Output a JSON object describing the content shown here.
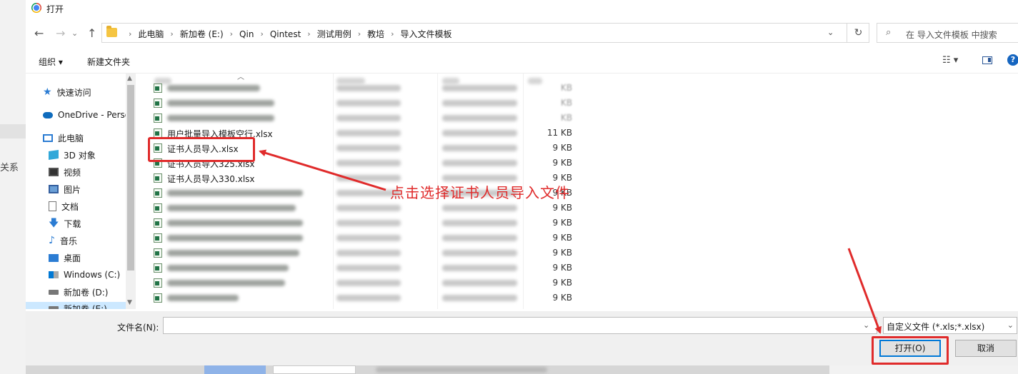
{
  "window": {
    "title": "打开"
  },
  "nav": {
    "back": "←",
    "forward": "→",
    "up": "↑",
    "refresh": "↻"
  },
  "breadcrumbs": [
    "此电脑",
    "新加卷 (E:)",
    "Qin",
    "Qintest",
    "测试用例",
    "教培",
    "导入文件模板"
  ],
  "search": {
    "placeholder": "在 导入文件模板 中搜索"
  },
  "toolbar": {
    "organize": "组织 ▾",
    "new_folder": "新建文件夹",
    "view": "☷ ▾"
  },
  "sidebar": {
    "items": [
      {
        "label": "快速访问",
        "icon": "star-icon"
      },
      {
        "label": "OneDrive - Perso",
        "icon": "cloud-icon"
      },
      {
        "label": "此电脑",
        "icon": "computer-icon"
      },
      {
        "label": "3D 对象",
        "icon": "cube-icon"
      },
      {
        "label": "视频",
        "icon": "video-icon"
      },
      {
        "label": "图片",
        "icon": "image-icon"
      },
      {
        "label": "文档",
        "icon": "document-icon"
      },
      {
        "label": "下载",
        "icon": "download-icon"
      },
      {
        "label": "音乐",
        "icon": "music-icon"
      },
      {
        "label": "桌面",
        "icon": "desktop-icon"
      },
      {
        "label": "Windows (C:)",
        "icon": "windows-drive-icon"
      },
      {
        "label": "新加卷 (D:)",
        "icon": "drive-icon"
      },
      {
        "label": "新加卷 (E:)",
        "icon": "drive-icon"
      }
    ]
  },
  "files": [
    {
      "name": "",
      "size": "KB",
      "blurred": true
    },
    {
      "name": "",
      "size": "KB",
      "blurred": true
    },
    {
      "name": "",
      "size": "KB",
      "blurred": true
    },
    {
      "name": "用户批量导入模板空行.xlsx",
      "size": "11 KB",
      "blurred": false
    },
    {
      "name": "证书人员导入.xlsx",
      "size": "9 KB",
      "blurred": false
    },
    {
      "name": "证书人员导入325.xlsx",
      "size": "9 KB",
      "blurred": false
    },
    {
      "name": "证书人员导入330.xlsx",
      "size": "9 KB",
      "blurred": false
    },
    {
      "name": "",
      "size": "9 KB",
      "blurred": true
    },
    {
      "name": "",
      "size": "9 KB",
      "blurred": true
    },
    {
      "name": "",
      "size": "9 KB",
      "blurred": true
    },
    {
      "name": "",
      "size": "9 KB",
      "blurred": true
    },
    {
      "name": "",
      "size": "9 KB",
      "blurred": true
    },
    {
      "name": "",
      "size": "9 KB",
      "blurred": true
    },
    {
      "name": "",
      "size": "9 KB",
      "blurred": true
    },
    {
      "name": "",
      "size": "9 KB",
      "blurred": true
    }
  ],
  "annotation": {
    "text": "点击选择证书人员导入文件",
    "color": "#e02b2b"
  },
  "footer": {
    "filename_label": "文件名(N):",
    "filename_value": "",
    "filter": "自定义文件 (*.xls;*.xlsx)",
    "open": "打开(O)",
    "cancel": "取消"
  },
  "background": {
    "side_text": "关系"
  }
}
